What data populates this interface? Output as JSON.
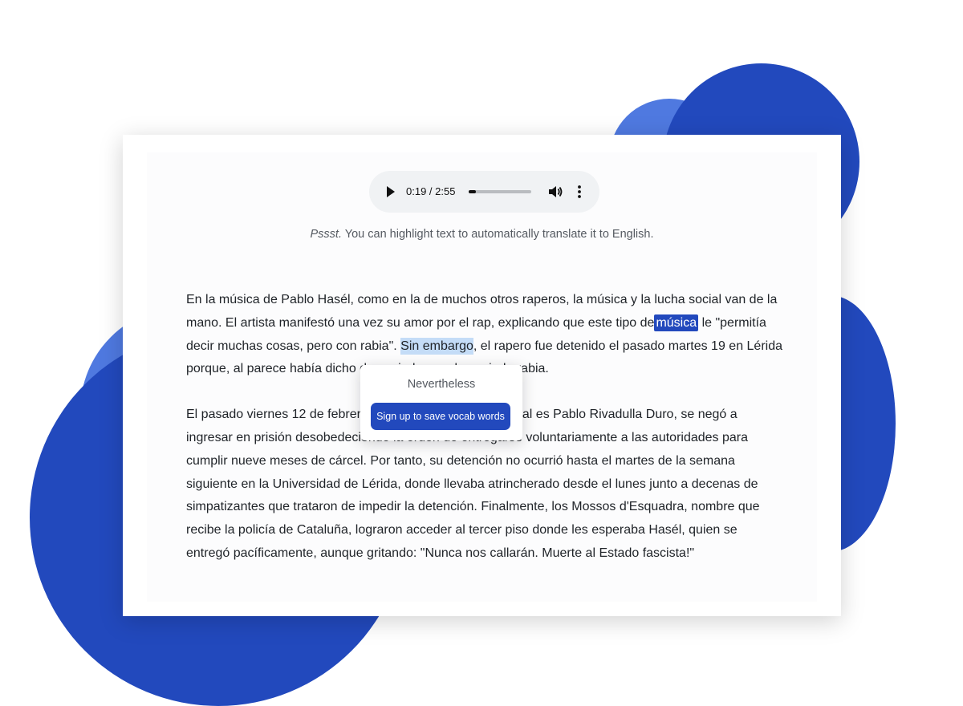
{
  "audio": {
    "time_display": "0:19 / 2:55",
    "progress": 0.11
  },
  "hint": {
    "prefix": "Pssst.",
    "text": " You can highlight text to automatically translate it to English."
  },
  "article": {
    "p1_a": "En la música de Pablo Hasél, como en la de muchos otros raperos, la música y la lucha social van de la mano. El artista manifestó una vez su amor por el rap, explicando que este tipo de",
    "p1_word": "música",
    "p1_b": " le \"permitía decir muchas cosas, pero con rabia\". ",
    "p1_selected": "Sin embargo",
    "p1_c": ", el rapero fue detenido el pasado martes 19 en Lérida porque, al parece había dicho demasiado con demasiada rabia.",
    "p2": "El pasado viernes 12 de febrero, el rapero, cuyo nombre real es Pablo Rivadulla Duro, se negó a ingresar en prisión desobedeciendo la orden de entregarse voluntariamente a las autoridades para cumplir nueve meses de cárcel. Por tanto, su detención no ocurrió hasta el martes de la semana siguiente en la Universidad de Lérida, donde llevaba atrincherado desde el lunes junto a decenas de simpatizantes que trataron de impedir la detención. Finalmente, los Mossos d'Esquadra, nombre que recibe la policía de Cataluña, lograron acceder al tercer piso donde les esperaba Hasél, quien se entregó pacíficamente, aunque gritando: \"Nunca nos callarán. Muerte al Estado fascista!\""
  },
  "popover": {
    "translation": "Nevertheless",
    "button_label": "Sign up to save vocab words"
  },
  "colors": {
    "accent": "#2249bd",
    "accent_light": "#4f79e0",
    "selection": "#c4dcf7"
  }
}
